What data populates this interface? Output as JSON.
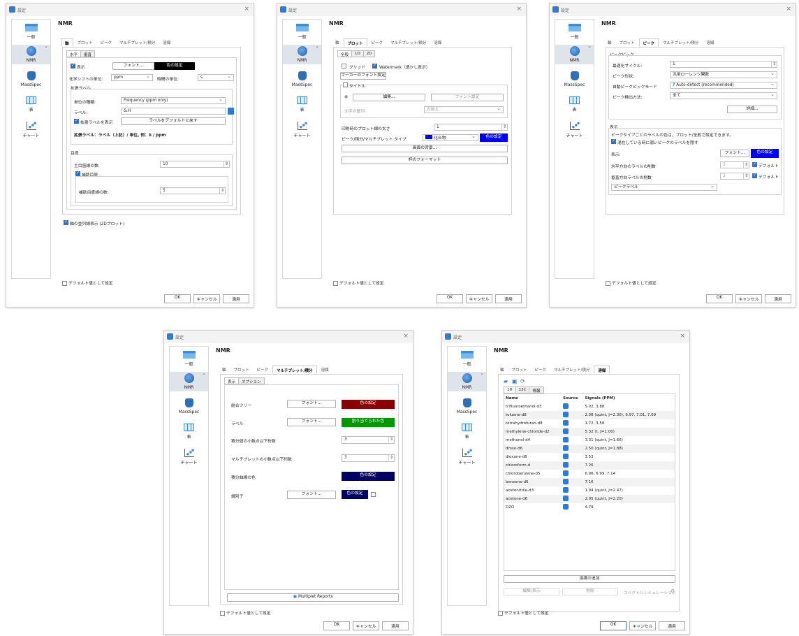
{
  "dialog": {
    "title": "設定",
    "close": "×",
    "ok": "OK",
    "cancel": "キャンセル",
    "apply": "適用",
    "set_default": "デフォルト値として設定"
  },
  "sidebar": [
    {
      "label": "一般",
      "icon": "general-icon"
    },
    {
      "label": "NMR",
      "icon": "nmr-icon"
    },
    {
      "label": "MassSpec",
      "icon": "massspec-icon"
    },
    {
      "label": "表",
      "icon": "table-icon"
    },
    {
      "label": "チャート",
      "icon": "chart-icon"
    }
  ],
  "page_title": "NMR",
  "tabs": [
    "軸",
    "プロット",
    "ピーク",
    "マルチプレット/積分",
    "溶媒"
  ],
  "colors": {
    "black": "#000000",
    "blue": "#0000ff",
    "darkred": "#8b0000",
    "green": "#009900",
    "navy": "#000066"
  },
  "axis": {
    "subtabs": [
      "水平",
      "垂直"
    ],
    "show": "表示",
    "font_btn": "フォント...",
    "color_btn": "色の設定",
    "chem_shift_label": "化学シフトの単位:",
    "chem_shift_value": "ppm",
    "time_unit_label": "時間の単位:",
    "time_unit_value": "s",
    "ext_label_group": "拡張ラベル",
    "unit_type_label": "単位の種類:",
    "unit_type_value": "Frequency (ppm only)",
    "label_label": "ラベル:",
    "label_value": "δ₁H",
    "show_ext": "拡張ラベルを表示",
    "reset_label": "ラベルをデフォルトに戻す",
    "ext_example": "拡張ラベル：ラベル（上記）/ 単位, 例：δ / ppm",
    "ticks_group": "目盛",
    "major_label": "主目盛線の数:",
    "major_value": "10",
    "minor_check": "補助目盛",
    "minor_label": "補助目盛線の数:",
    "minor_value": "5",
    "stack_check": "軸の並列線表示 (2Dプロット)"
  },
  "plot": {
    "subtabs": [
      "全般",
      "1D",
      "2D"
    ],
    "grid": "グリッド",
    "watermark": "Watermark（透かし表示）",
    "marker_font": "マーカーのフォント設定",
    "title_check": "タイトル",
    "edit_btn": "編集...",
    "font_btn": "フォント設定",
    "align_label": "文字の整列",
    "align_value": "左揃え",
    "print_size_label": "印刷時のプロット線の太さ",
    "print_size_value": "1",
    "type_label": "ピーク/積分/マルチプレット タイプ",
    "type_value": "化合物",
    "color_btn": "色の設定",
    "bg_btn": "画面の背景...",
    "frame_btn": "枠のフォーマット"
  },
  "peaks": {
    "group": "ピークピック",
    "cycles_label": "最適化サイクル:",
    "cycles_value": "1",
    "shape_label": "ピーク形状:",
    "shape_value": "汎用ローレンツ関数",
    "mode_label": "自動ピークピックモード",
    "mode_value": "Auto-detect (recommended)",
    "method_label": "ピーク検出方法:",
    "method_value": "全て",
    "detail_btn": "詳細...",
    "disp_group": "表示",
    "disp_note": "ピークタイプごとのラベルの色は、プロット/全般で設定できます。",
    "hide_check": "混在している時に弱いピークのラベルを隠す",
    "disp_label": "表示:",
    "font_btn": "フォント...",
    "color_btn": "色の設定",
    "h_label": "水平方向のラベルの削数",
    "h_value": "3",
    "v_label": "垂直方向ラベルの削数",
    "v_value": "3",
    "default_check": "デフォルト",
    "label_select": "ピークラベル"
  },
  "multiplet": {
    "subtabs": [
      "表示",
      "オプション"
    ],
    "tree_label": "結合ツリー",
    "font_btn": "フォント...",
    "color_btn": "色の設定",
    "label_label": "ラベル",
    "assign_btn": "割り当てられた色",
    "int_dec_label": "積分値の小数点以下桁数",
    "int_dec_value": "3",
    "mul_dec_label": "マルチプレットの小数点以下桁数",
    "mul_dec_value": "3",
    "curve_label": "積分曲線の色",
    "sep_label": "識別子",
    "reports_btn": "Multiplet Reports"
  },
  "solvents": {
    "subtabs": [
      "1H",
      "13C",
      "情報"
    ],
    "headers": [
      "Name",
      "Source",
      "Signals (PPM)"
    ],
    "rows": [
      [
        "trifluoroethanol-d3",
        "5.02, 3.88"
      ],
      [
        "toluene-d8",
        "2.08 (quint, J=2.30), 6.97, 7.01, 7.09"
      ],
      [
        "tetrahydrofuran-d8",
        "1.72, 3.58"
      ],
      [
        "methylene-chloride-d2",
        "5.32 (t, J=1.00)"
      ],
      [
        "methanol-d4",
        "3.31 (quint, J=1.66)"
      ],
      [
        "dmso-d6",
        "2.50 (quint, J=1.88)"
      ],
      [
        "dioxane-d8",
        "3.53"
      ],
      [
        "chloroform-d",
        "7.26"
      ],
      [
        "chlorobenzene-d5",
        "6.96, 6.99, 7.14"
      ],
      [
        "benzene-d6",
        "7.16"
      ],
      [
        "acetonitrile-d3",
        "1.94 (quint, J=2.47)"
      ],
      [
        "acetone-d6",
        "2.05 (quint, J=2.20)"
      ],
      [
        "D2O",
        "4.79"
      ]
    ],
    "add_btn": "溶媒の追加",
    "edit_btn": "編集/表示",
    "del_btn": "削除",
    "sim_btn": "スペクトルシミュレーション"
  }
}
